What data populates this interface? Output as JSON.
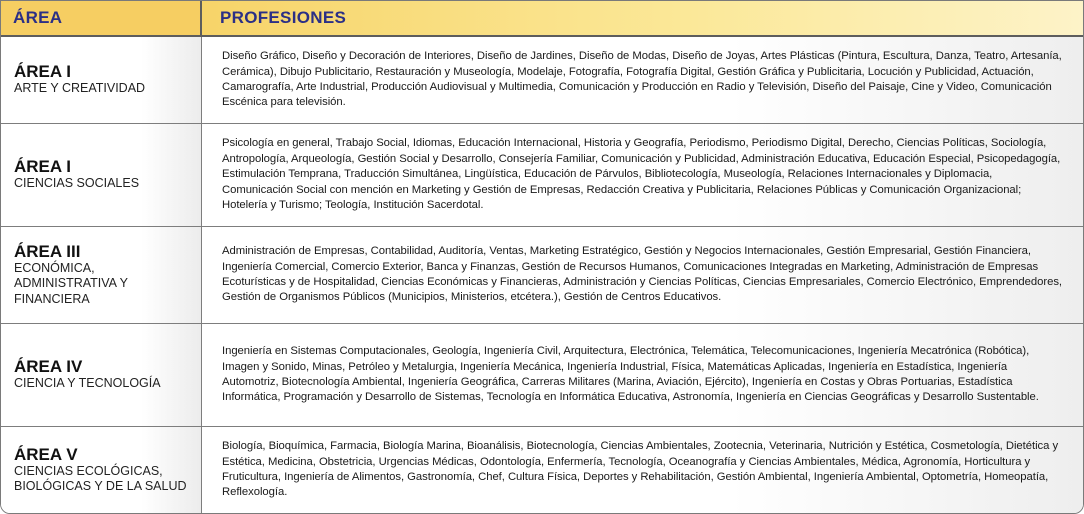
{
  "header": {
    "area": "ÁREA",
    "profesiones": "PROFESIONES"
  },
  "rows": [
    {
      "area_title": "ÁREA I",
      "area_subtitle": "ARTE Y CREATIVIDAD",
      "profesiones": "Diseño Gráfico, Diseño y Decoración de Interiores, Diseño de Jardines, Diseño de Modas, Diseño de Joyas, Artes Plásticas (Pintura, Escultura, Danza, Teatro, Artesanía, Cerámica),  Dibujo Publicitario, Restauración y Museología, Modelaje, Fotografía, Fotografía Digital,  Gestión Gráfica y Publicitaria, Locución y Publicidad, Actuación, Camarografía, Arte Industrial, Producción Audiovisual y Multimedia, Comunicación y Producción en Radio y Televisión, Diseño del Paisaje,  Cine y Video, Comunicación Escénica para televisión."
    },
    {
      "area_title": "ÁREA I",
      "area_subtitle": "CIENCIAS SOCIALES",
      "profesiones": "Psicología en general, Trabajo Social, Idiomas, Educación  Internacional,  Historia y Geografía, Periodismo, Periodismo Digital, Derecho, Ciencias Políticas, Sociología, Antropología, Arqueología,  Gestión Social y Desarrollo, Consejería Familiar, Comunicación y Publicidad, Administración Educativa, Educación Especial, Psicopedagogía, Estimulación Temprana,  Traducción Simultánea, Lingüística, Educación de Párvulos, Bibliotecología, Museología, Relaciones Internacionales y Diplomacia, Comunicación Social con mención en Marketing y Gestión de Empresas, Redacción Creativa y Publicitaria,  Relaciones Públicas y Comunicación Organizacional; Hotelería y Turismo; Teología, Institución Sacerdotal."
    },
    {
      "area_title": "ÁREA III",
      "area_subtitle": "ECONÓMICA, ADMINISTRATIVA Y FINANCIERA",
      "profesiones": "Administración de Empresas, Contabilidad, Auditoría, Ventas,  Marketing Estratégico, Gestión y  Negocios Internacionales, Gestión Empresarial, Gestión Financiera,  Ingeniería Comercial, Comercio Exterior, Banca y Finanzas, Gestión de Recursos Humanos, Comunicaciones Integradas en Marketing, Administración de Empresas Ecoturísticas y de Hospitalidad, Ciencias Económicas y Financieras, Administración y Ciencias Políticas, Ciencias Empresariales, Comercio Electrónico, Emprendedores, Gestión de Organismos Públicos (Municipios, Ministerios, etcétera.), Gestión de Centros Educativos."
    },
    {
      "area_title": "ÁREA IV",
      "area_subtitle": "CIENCIA Y TECNOLOGÍA",
      "profesiones": "Ingeniería en Sistemas Computacionales,  Geología, Ingeniería Civil, Arquitectura, Electrónica, Telemática, Telecomunicaciones, Ingeniería Mecatrónica  (Robótica), Imagen y Sonido,  Minas, Petróleo y Metalurgia,  Ingeniería Mecánica, Ingeniería Industrial, Física, Matemáticas Aplicadas, Ingeniería en Estadística, Ingeniería Automotriz, Biotecnología Ambiental, Ingeniería Geográfica, Carreras Militares (Marina, Aviación, Ejército), Ingeniería en Costas y Obras Portuarias, Estadística Informática, Programación y Desarrollo de Sistemas, Tecnología en Informática Educativa, Astronomía, Ingeniería en Ciencias Geográficas y Desarrollo Sustentable."
    },
    {
      "area_title": "ÁREA V",
      "area_subtitle": "CIENCIAS ECOLÓGICAS, BIOLÓGICAS Y DE LA SALUD",
      "profesiones": "Biología, Bioquímica, Farmacia, Biología Marina, Bioanálisis, Biotecnología, Ciencias Ambientales,  Zootecnia, Veterinaria, Nutrición y Estética, Cosmetología,  Dietética y Estética, Medicina, Obstetricia, Urgencias Médicas, Odontología, Enfermería, Tecnología, Oceanografía y Ciencias Ambientales, Médica, Agronomía, Horticultura y Fruticultura, Ingeniería de Alimentos, Gastronomía, Chef, Cultura Física, Deportes y Rehabilitación, Gestión Ambiental, Ingeniería Ambiental, Optometría, Homeopatía, Reflexología."
    }
  ]
}
